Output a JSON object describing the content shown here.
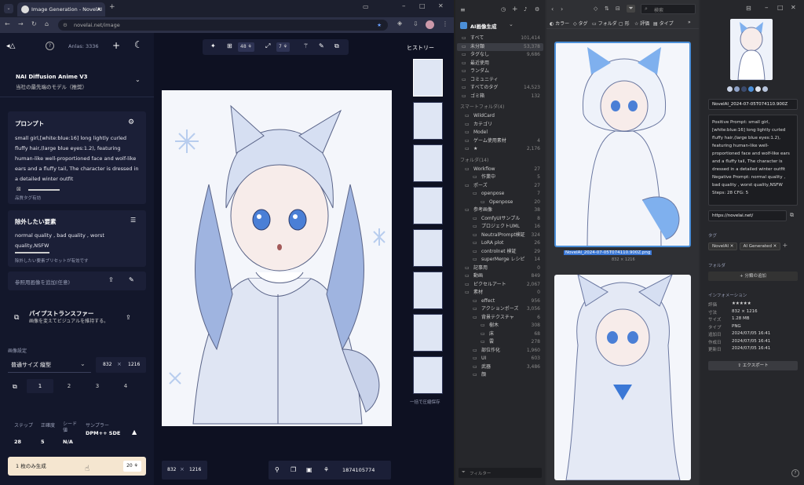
{
  "browser": {
    "tab_title": "Image Generation - NovelAI",
    "url": "novelai.net/image"
  },
  "nai": {
    "anlas": "Anlas: 3336",
    "model_name": "NAI Diffusion Anime V3",
    "model_desc": "当社の最先端のモデル（推奨）",
    "prompt_title": "プロンプト",
    "prompt_text": "small girl,[white:blue:16] long lightly curled fluffy hair,(large blue eyes:1.2), featuring human-like well-proportioned face and wolf-like ears and a fluffy tail, The character is dressed in a detailed winter outfit",
    "quality_tags": "品質タグ有効",
    "undesired_title": "除外したい要素",
    "undesired_text": "normal quality , bad quality , worst quality,NSFW",
    "undesired_preset": "除外したい要素プリセットが有効です",
    "ref_image": "参照用画像を追加(任意)",
    "pipeline_title": "パイプストランスファー",
    "pipeline_desc": "画像を変えてビジュアルを維持する。",
    "image_settings": "画像設定",
    "size_preset": "普通サイズ 縦型",
    "width": "832",
    "height": "1216",
    "times": "×",
    "counts": [
      "1",
      "2",
      "3",
      "4"
    ],
    "steps_label": "ステップ",
    "guidance_label": "正確度",
    "seed_label": "シード値",
    "sampler_label": "サンプラー",
    "steps": "28",
    "guidance": "5",
    "seed": "N/A",
    "sampler": "DPM++ SDE",
    "generate_label": "1 枚のみ生成",
    "generate_cost": "20",
    "toolbar_count1": "48",
    "toolbar_count2": "7",
    "bottom_w": "832",
    "bottom_h": "1216",
    "bottom_seed": "1874105774",
    "history_title": "ヒストリー",
    "history_footer": "一括で圧縮保存"
  },
  "eagle": {
    "library": "AI画像生成",
    "search_placeholder": "検索",
    "sidebar": [
      {
        "label": "すべて",
        "count": "101,414"
      },
      {
        "label": "未分類",
        "count": "53,378"
      },
      {
        "label": "タグなし",
        "count": "9,686"
      },
      {
        "label": "最近使用",
        "count": ""
      },
      {
        "label": "ランダム",
        "count": ""
      },
      {
        "label": "コミュニティ",
        "count": ""
      },
      {
        "label": "すべてのタグ",
        "count": "14,523"
      },
      {
        "label": "ゴミ箱",
        "count": "132"
      }
    ],
    "smart_heading": "スマートフォルダ(4)",
    "smart": [
      {
        "label": "WildCard",
        "count": ""
      },
      {
        "label": "カテゴリ",
        "count": ""
      },
      {
        "label": "Model",
        "count": ""
      },
      {
        "label": "ゲーム使用素材",
        "count": "4"
      },
      {
        "label": "★",
        "count": "2,176"
      }
    ],
    "folder_heading": "フォルダ(14)",
    "folders": [
      {
        "label": "Workflow",
        "count": "27"
      },
      {
        "label": "作業中",
        "count": "5"
      },
      {
        "label": "ポーズ",
        "count": "27"
      },
      {
        "label": "openpose",
        "count": "7"
      },
      {
        "label": "Openpose",
        "count": "20"
      },
      {
        "label": "参考画像",
        "count": "38"
      },
      {
        "label": "ComfyUIサンプル",
        "count": "8"
      },
      {
        "label": "プロジェクトUML",
        "count": "16"
      },
      {
        "label": "NeutralPrompt検証",
        "count": "324"
      },
      {
        "label": "LoRA plot",
        "count": "26"
      },
      {
        "label": "controlnet 検証",
        "count": "29"
      },
      {
        "label": "superMerge レシピ",
        "count": "14"
      },
      {
        "label": "記事用",
        "count": "0"
      },
      {
        "label": "動画",
        "count": "849"
      },
      {
        "label": "ピクセルアート",
        "count": "2,067"
      },
      {
        "label": "素材",
        "count": "0"
      },
      {
        "label": "effect",
        "count": "956"
      },
      {
        "label": "アクションポーズ",
        "count": "3,056"
      },
      {
        "label": "背景テクスチャ",
        "count": "6"
      },
      {
        "label": "樹木",
        "count": "308"
      },
      {
        "label": "床",
        "count": "68"
      },
      {
        "label": "雲",
        "count": "278"
      },
      {
        "label": "部位作化",
        "count": "1,960"
      },
      {
        "label": "UI",
        "count": "603"
      },
      {
        "label": "武器",
        "count": "3,486"
      },
      {
        "label": "顔",
        "count": ""
      }
    ],
    "filter_label": "フィルター",
    "toolbar": [
      "カラー",
      "タグ",
      "フォルダ",
      "形",
      "評価",
      "タイプ"
    ],
    "selected_file": "NovelAI_2024-07-05T074110.900Z.png",
    "selected_dims": "832 × 1216",
    "filename": "NovelAI_2024-07-05T074110.900Z",
    "notes": "Positive Prompt: small girl, [white:blue:16] long lightly curled fluffy hair,(large blue eyes:1.2), featuring human-like well-proportioned face and wolf-like ears and a fluffy tail, The character is dressed in a detailed winter outfit Negative Prompt: normal quality , bad quality , worst quality,NSFW Steps: 28 CFG: 5",
    "source_url": "https://novelai.net/",
    "tags_heading": "タグ",
    "tags": [
      "NovelAI",
      "AI Generated"
    ],
    "folder_label": "フォルダ",
    "add_folder": "+ 分類の追加",
    "info_heading": "インフォメーション",
    "info": [
      {
        "k": "評価",
        "v": "★★★★★"
      },
      {
        "k": "寸法",
        "v": "832 × 1216"
      },
      {
        "k": "サイズ",
        "v": "1.28 MB"
      },
      {
        "k": "タイプ",
        "v": "PNG"
      },
      {
        "k": "追加日",
        "v": "2024/07/05 16:41"
      },
      {
        "k": "作成日",
        "v": "2024/07/05 16:41"
      },
      {
        "k": "更新日",
        "v": "2024/07/05 16:41"
      }
    ],
    "export_label": "エクスポート",
    "swatches": [
      "#c9d3e6",
      "#8fa2c7",
      "#3b4a6c",
      "#4b8fd8",
      "#dfe4ee",
      "#b6c3db"
    ]
  }
}
